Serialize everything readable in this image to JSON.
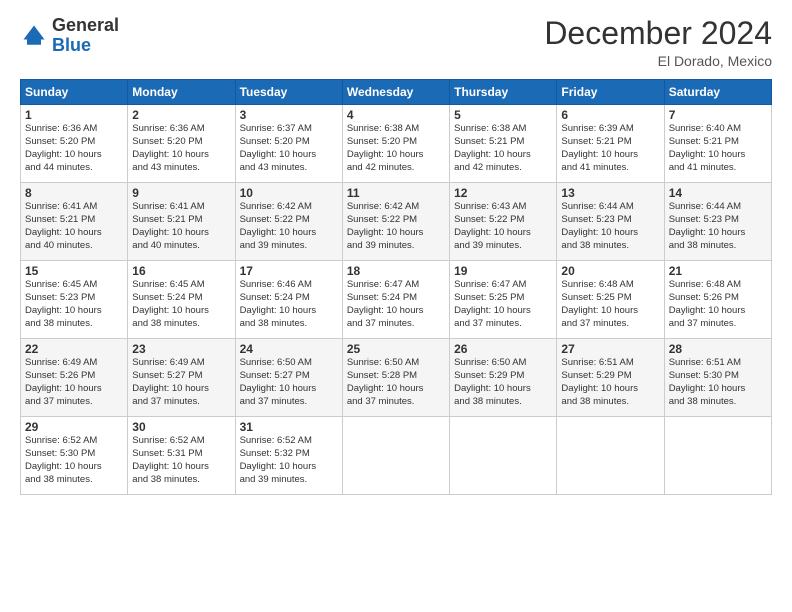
{
  "logo": {
    "general": "General",
    "blue": "Blue"
  },
  "title": "December 2024",
  "location": "El Dorado, Mexico",
  "days_header": [
    "Sunday",
    "Monday",
    "Tuesday",
    "Wednesday",
    "Thursday",
    "Friday",
    "Saturday"
  ],
  "weeks": [
    [
      {
        "day": "1",
        "info": "Sunrise: 6:36 AM\nSunset: 5:20 PM\nDaylight: 10 hours\nand 44 minutes."
      },
      {
        "day": "2",
        "info": "Sunrise: 6:36 AM\nSunset: 5:20 PM\nDaylight: 10 hours\nand 43 minutes."
      },
      {
        "day": "3",
        "info": "Sunrise: 6:37 AM\nSunset: 5:20 PM\nDaylight: 10 hours\nand 43 minutes."
      },
      {
        "day": "4",
        "info": "Sunrise: 6:38 AM\nSunset: 5:20 PM\nDaylight: 10 hours\nand 42 minutes."
      },
      {
        "day": "5",
        "info": "Sunrise: 6:38 AM\nSunset: 5:21 PM\nDaylight: 10 hours\nand 42 minutes."
      },
      {
        "day": "6",
        "info": "Sunrise: 6:39 AM\nSunset: 5:21 PM\nDaylight: 10 hours\nand 41 minutes."
      },
      {
        "day": "7",
        "info": "Sunrise: 6:40 AM\nSunset: 5:21 PM\nDaylight: 10 hours\nand 41 minutes."
      }
    ],
    [
      {
        "day": "8",
        "info": "Sunrise: 6:41 AM\nSunset: 5:21 PM\nDaylight: 10 hours\nand 40 minutes."
      },
      {
        "day": "9",
        "info": "Sunrise: 6:41 AM\nSunset: 5:21 PM\nDaylight: 10 hours\nand 40 minutes."
      },
      {
        "day": "10",
        "info": "Sunrise: 6:42 AM\nSunset: 5:22 PM\nDaylight: 10 hours\nand 39 minutes."
      },
      {
        "day": "11",
        "info": "Sunrise: 6:42 AM\nSunset: 5:22 PM\nDaylight: 10 hours\nand 39 minutes."
      },
      {
        "day": "12",
        "info": "Sunrise: 6:43 AM\nSunset: 5:22 PM\nDaylight: 10 hours\nand 39 minutes."
      },
      {
        "day": "13",
        "info": "Sunrise: 6:44 AM\nSunset: 5:23 PM\nDaylight: 10 hours\nand 38 minutes."
      },
      {
        "day": "14",
        "info": "Sunrise: 6:44 AM\nSunset: 5:23 PM\nDaylight: 10 hours\nand 38 minutes."
      }
    ],
    [
      {
        "day": "15",
        "info": "Sunrise: 6:45 AM\nSunset: 5:23 PM\nDaylight: 10 hours\nand 38 minutes."
      },
      {
        "day": "16",
        "info": "Sunrise: 6:45 AM\nSunset: 5:24 PM\nDaylight: 10 hours\nand 38 minutes."
      },
      {
        "day": "17",
        "info": "Sunrise: 6:46 AM\nSunset: 5:24 PM\nDaylight: 10 hours\nand 38 minutes."
      },
      {
        "day": "18",
        "info": "Sunrise: 6:47 AM\nSunset: 5:24 PM\nDaylight: 10 hours\nand 37 minutes."
      },
      {
        "day": "19",
        "info": "Sunrise: 6:47 AM\nSunset: 5:25 PM\nDaylight: 10 hours\nand 37 minutes."
      },
      {
        "day": "20",
        "info": "Sunrise: 6:48 AM\nSunset: 5:25 PM\nDaylight: 10 hours\nand 37 minutes."
      },
      {
        "day": "21",
        "info": "Sunrise: 6:48 AM\nSunset: 5:26 PM\nDaylight: 10 hours\nand 37 minutes."
      }
    ],
    [
      {
        "day": "22",
        "info": "Sunrise: 6:49 AM\nSunset: 5:26 PM\nDaylight: 10 hours\nand 37 minutes."
      },
      {
        "day": "23",
        "info": "Sunrise: 6:49 AM\nSunset: 5:27 PM\nDaylight: 10 hours\nand 37 minutes."
      },
      {
        "day": "24",
        "info": "Sunrise: 6:50 AM\nSunset: 5:27 PM\nDaylight: 10 hours\nand 37 minutes."
      },
      {
        "day": "25",
        "info": "Sunrise: 6:50 AM\nSunset: 5:28 PM\nDaylight: 10 hours\nand 37 minutes."
      },
      {
        "day": "26",
        "info": "Sunrise: 6:50 AM\nSunset: 5:29 PM\nDaylight: 10 hours\nand 38 minutes."
      },
      {
        "day": "27",
        "info": "Sunrise: 6:51 AM\nSunset: 5:29 PM\nDaylight: 10 hours\nand 38 minutes."
      },
      {
        "day": "28",
        "info": "Sunrise: 6:51 AM\nSunset: 5:30 PM\nDaylight: 10 hours\nand 38 minutes."
      }
    ],
    [
      {
        "day": "29",
        "info": "Sunrise: 6:52 AM\nSunset: 5:30 PM\nDaylight: 10 hours\nand 38 minutes."
      },
      {
        "day": "30",
        "info": "Sunrise: 6:52 AM\nSunset: 5:31 PM\nDaylight: 10 hours\nand 38 minutes."
      },
      {
        "day": "31",
        "info": "Sunrise: 6:52 AM\nSunset: 5:32 PM\nDaylight: 10 hours\nand 39 minutes."
      },
      {
        "day": "",
        "info": ""
      },
      {
        "day": "",
        "info": ""
      },
      {
        "day": "",
        "info": ""
      },
      {
        "day": "",
        "info": ""
      }
    ]
  ]
}
